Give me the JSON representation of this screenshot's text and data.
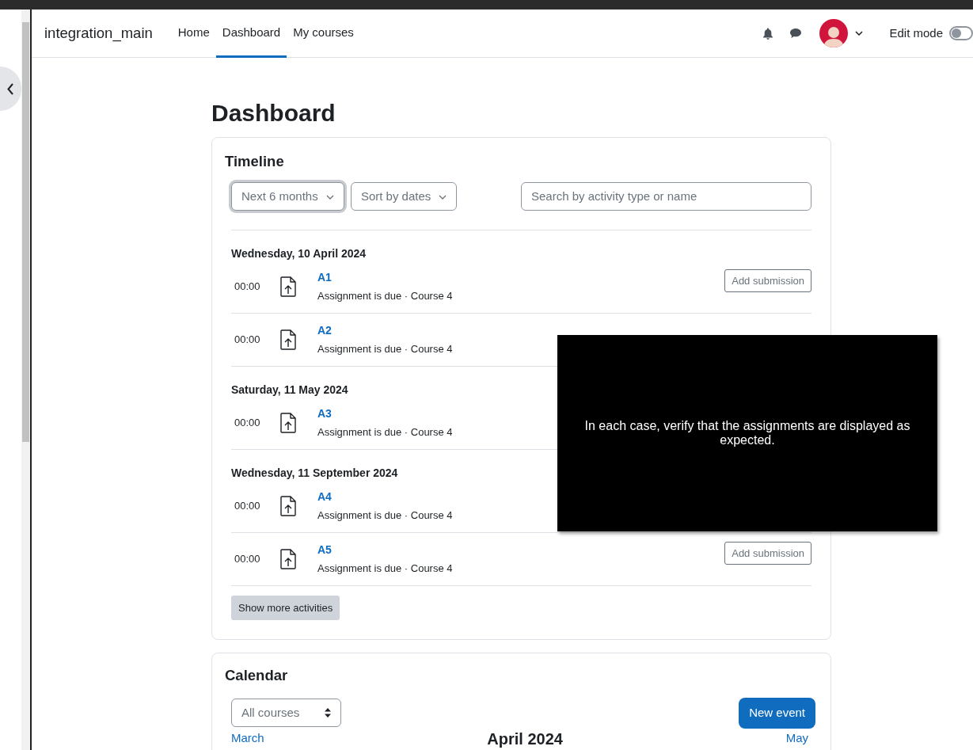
{
  "header": {
    "site_name": "integration_main",
    "nav": [
      {
        "label": "Home",
        "selected": false
      },
      {
        "label": "Dashboard",
        "selected": true
      },
      {
        "label": "My courses",
        "selected": false
      }
    ],
    "edit_mode": {
      "label": "Edit mode",
      "on": false
    }
  },
  "page_title": "Dashboard",
  "timeline": {
    "title": "Timeline",
    "filters": [
      {
        "label": "Next 6 months",
        "focused": true
      },
      {
        "label": "Sort by dates",
        "focused": false
      }
    ],
    "search": {
      "placeholder": "Search by activity type or name"
    },
    "groups": [
      {
        "date": "Wednesday, 10 April 2024",
        "items": [
          {
            "time": "00:00",
            "name": "A1",
            "detail": "Assignment is due · Course 4",
            "action": "Add submission"
          },
          {
            "time": "00:00",
            "name": "A2",
            "detail": "Assignment is due · Course 4"
          }
        ]
      },
      {
        "date": "Saturday, 11 May 2024",
        "items": [
          {
            "time": "00:00",
            "name": "A3",
            "detail": "Assignment is due · Course 4"
          }
        ]
      },
      {
        "date": "Wednesday, 11 September 2024",
        "items": [
          {
            "time": "00:00",
            "name": "A4",
            "detail": "Assignment is due · Course 4"
          },
          {
            "time": "00:00",
            "name": "A5",
            "detail": "Assignment is due · Course 4",
            "action": "Add submission"
          }
        ]
      }
    ],
    "more_button": "Show more activities"
  },
  "calendar": {
    "title": "Calendar",
    "course_filter": "All courses",
    "new_event": "New event",
    "prev": "March",
    "month": "April 2024",
    "next": "May"
  },
  "overlay": {
    "text": "In each case, verify that the assignments are displayed as expected."
  }
}
